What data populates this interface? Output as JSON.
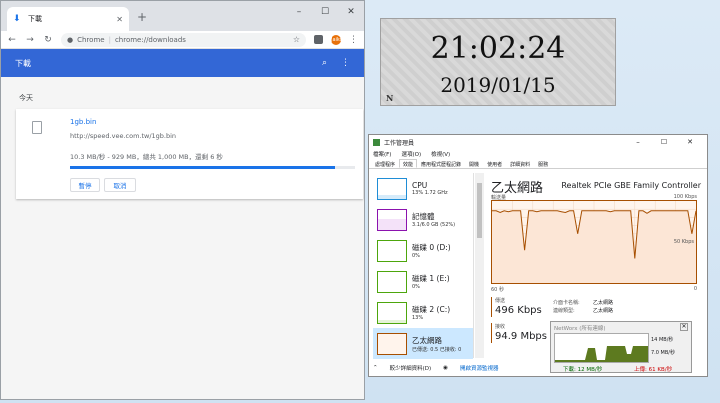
{
  "chrome": {
    "tab_title": "下載",
    "omnibox_chrome": "Chrome",
    "omnibox_url": "chrome://downloads",
    "avatar_text": "Jaiko",
    "page_title": "下載",
    "date_group": "今天",
    "download": {
      "file_name": "1gb.bin",
      "source_url": "http://speed.vee.com.tw/1gb.bin",
      "status": "10.3 MB/秒 - 929 MB，總共 1,000 MB，還剩 6 秒",
      "progress": 0.93,
      "pause_label": "暫停",
      "cancel_label": "取消"
    },
    "colors": {
      "accent": "#3367d6",
      "link": "#1a73e8"
    }
  },
  "clock": {
    "time": "21:02:24",
    "date": "2019/01/15",
    "mark": "N"
  },
  "task_manager": {
    "title": "工作管理員",
    "menu": [
      "檔案(F)",
      "選項(O)",
      "檢視(V)"
    ],
    "tabs": [
      "處理程序",
      "效能",
      "應用程式歷程記錄",
      "開機",
      "使用者",
      "詳細資料",
      "服務"
    ],
    "active_tab": 1,
    "side": [
      {
        "name": "CPU",
        "value": "13% 1.72 GHz",
        "color": "#1f8dd6"
      },
      {
        "name": "記憶體",
        "value": "3.1/6.0 GB (52%)",
        "color": "#8b12ae"
      },
      {
        "name": "磁碟 0 (D:)",
        "value": "0%",
        "color": "#4da60c"
      },
      {
        "name": "磁碟 1 (E:)",
        "value": "0%",
        "color": "#4da60c"
      },
      {
        "name": "磁碟 2 (C:)",
        "value": "13%",
        "color": "#4da60c"
      },
      {
        "name": "乙太網路",
        "value": "已傳送: 0.5 已接收: 0",
        "color": "#a74f01"
      }
    ],
    "main": {
      "title": "乙太網路",
      "adapter": "Realtek PCIe GBE Family Controller",
      "graph_top_label": "輸送量",
      "graph_max": "100 Kbps",
      "graph_mid": "50 Kbps",
      "graph_left": "60 秒",
      "graph_right": "0",
      "throughput_pct": [
        88,
        88,
        86,
        88,
        87,
        88,
        88,
        88,
        40,
        88,
        88,
        87,
        88,
        88,
        88,
        88,
        88,
        87,
        86,
        88,
        88,
        60,
        88,
        88,
        88,
        88,
        88,
        88,
        88,
        87,
        88,
        88,
        88,
        88,
        88,
        30,
        88,
        88,
        85,
        88,
        88,
        88,
        88,
        88,
        88,
        88,
        88,
        88,
        88,
        60,
        88
      ],
      "send_label": "傳送",
      "send_value": "496 Kbps",
      "recv_label": "接收",
      "recv_value": "94.9 Mbps",
      "adapter_name_label": "介面卡名稱:",
      "adapter_name_value": "乙太網路",
      "conn_type_label": "連線類型:",
      "conn_type_value": "乙太網路"
    },
    "footer": {
      "less_details": "較少詳細資料(D)",
      "resource_monitor": "開啟資源監視器"
    }
  },
  "networx": {
    "title": "NetWorx (所有連線)",
    "scale_top": "14 MB/秒",
    "scale_mid": "7.0 MB/秒",
    "down": "下載: 12 MB/秒",
    "up": "上傳: 61 KB/秒"
  }
}
